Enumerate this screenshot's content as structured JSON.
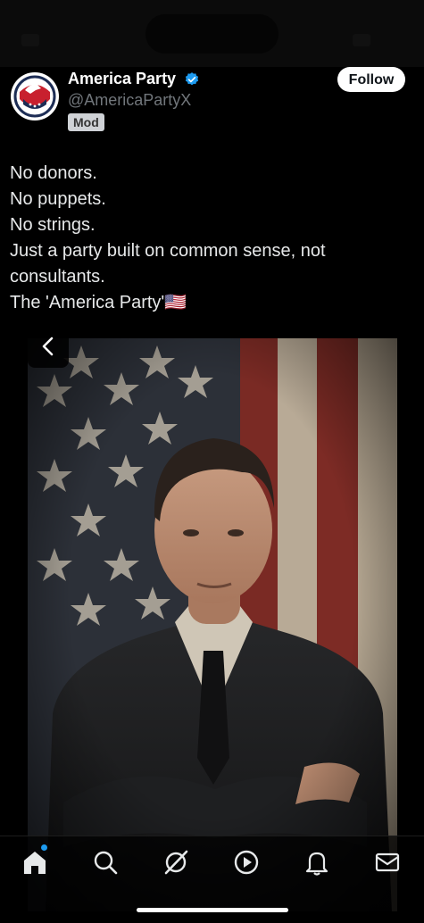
{
  "profile": {
    "name": "America Party",
    "handle": "@AmericaPartyX",
    "badge": "Mod",
    "follow_label": "Follow"
  },
  "tweet": {
    "lines": [
      "No donors.",
      "No puppets.",
      "No strings.",
      "Just a party built on common sense, not consultants.",
      "The 'America Party'🇺🇸"
    ]
  },
  "tabs": [
    {
      "name": "home",
      "icon": "home-icon",
      "active": true
    },
    {
      "name": "search",
      "icon": "search-icon"
    },
    {
      "name": "grok",
      "icon": "grok-icon"
    },
    {
      "name": "video",
      "icon": "play-icon"
    },
    {
      "name": "notifications",
      "icon": "bell-icon"
    },
    {
      "name": "messages",
      "icon": "mail-icon"
    }
  ],
  "colors": {
    "verified": "#1d9bf0",
    "handle": "#71767b",
    "background": "#000000"
  }
}
